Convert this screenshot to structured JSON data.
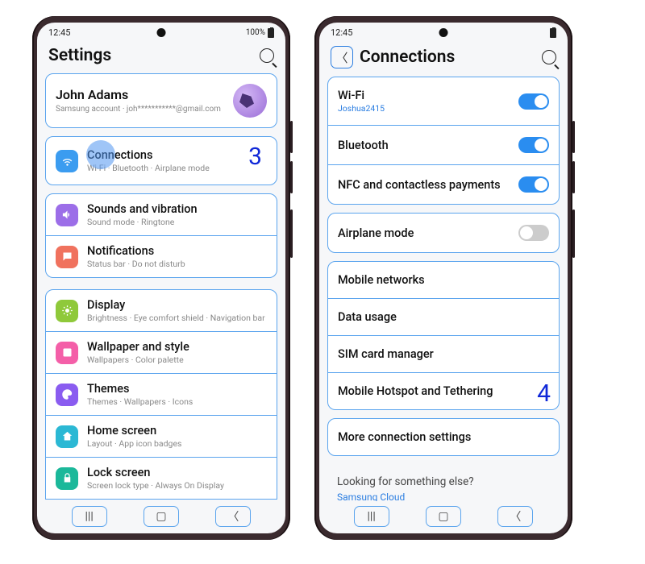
{
  "status": {
    "time": "12:45",
    "battery": "100%"
  },
  "phone1": {
    "title": "Settings",
    "account": {
      "name": "John Adams",
      "sub": "Samsung account · joh***********@gmail.com"
    },
    "items": [
      {
        "title": "Connections",
        "sub": "Wi-Fi · Bluetooth · Airplane mode"
      },
      {
        "title": "Sounds and vibration",
        "sub": "Sound mode · Ringtone"
      },
      {
        "title": "Notifications",
        "sub": "Status bar · Do not disturb"
      },
      {
        "title": "Display",
        "sub": "Brightness · Eye comfort shield · Navigation bar"
      },
      {
        "title": "Wallpaper and style",
        "sub": "Wallpapers · Color palette"
      },
      {
        "title": "Themes",
        "sub": "Themes · Wallpapers · Icons"
      },
      {
        "title": "Home screen",
        "sub": "Layout · App icon badges"
      },
      {
        "title": "Lock screen",
        "sub": "Screen lock type · Always On Display"
      }
    ],
    "step": "3"
  },
  "phone2": {
    "title": "Connections",
    "toggles": [
      {
        "title": "Wi-Fi",
        "sub": "Joshua2415",
        "on": true
      },
      {
        "title": "Bluetooth",
        "on": true
      },
      {
        "title": "NFC and contactless payments",
        "on": true
      },
      {
        "title": "Airplane mode",
        "on": false
      }
    ],
    "links": [
      "Mobile networks",
      "Data usage",
      "SIM card manager",
      "Mobile Hotspot and Tethering",
      "More connection settings"
    ],
    "footer": "Looking for something else?",
    "footerLink": "Samsung Cloud",
    "step": "4"
  }
}
